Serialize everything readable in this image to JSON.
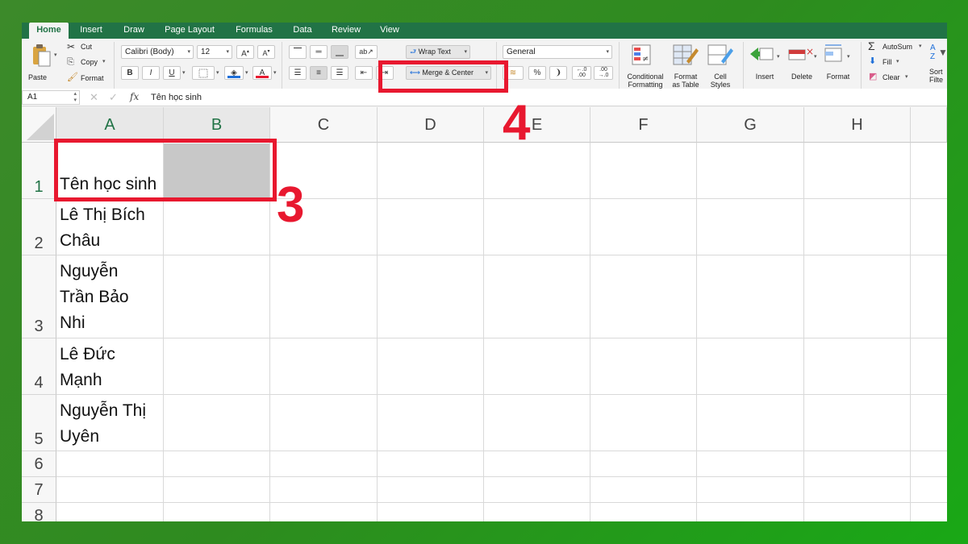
{
  "tabs": [
    "Home",
    "Insert",
    "Draw",
    "Page Layout",
    "Formulas",
    "Data",
    "Review",
    "View"
  ],
  "clipboard": {
    "paste": "Paste",
    "cut": "Cut",
    "copy": "Copy",
    "format": "Format"
  },
  "font": {
    "name": "Calibri (Body)",
    "size": "12",
    "bold": "B",
    "italic": "I",
    "underline": "U"
  },
  "alignment": {
    "wrap_text": "Wrap Text",
    "merge_center": "Merge & Center"
  },
  "number": {
    "format": "General",
    "percent": "%"
  },
  "styles": {
    "conditional": "Conditional",
    "conditional2": "Formatting",
    "format_table": "Format",
    "format_table2": "as Table",
    "cell_styles": "Cell",
    "cell_styles2": "Styles"
  },
  "cells_group": {
    "insert": "Insert",
    "delete": "Delete",
    "format": "Format"
  },
  "editing": {
    "autosum": "AutoSum",
    "fill": "Fill",
    "clear": "Clear",
    "sort": "Sort",
    "sort2": "Filte"
  },
  "formula_bar": {
    "name_box": "A1",
    "fx": "fx",
    "content": "Tên học sinh"
  },
  "columns": [
    "A",
    "B",
    "C",
    "D",
    "E",
    "F",
    "G",
    "H"
  ],
  "rows": [
    "1",
    "2",
    "3",
    "4",
    "5",
    "6",
    "7",
    "8"
  ],
  "cells": {
    "a1": "Tên học sinh",
    "a2": [
      "Lê Thị Bích",
      "Châu"
    ],
    "a3": [
      "Nguyễn",
      "Trần Bảo",
      "Nhi"
    ],
    "a4": [
      "Lê Đức",
      "Mạnh"
    ],
    "a5": [
      "Nguyễn Thị",
      "Uyên"
    ]
  },
  "annotations": {
    "step3": "3",
    "step4": "4"
  },
  "colors": {
    "accent": "#217346",
    "highlight": "#e8182f",
    "selected_fill": "#c8c8c8"
  }
}
